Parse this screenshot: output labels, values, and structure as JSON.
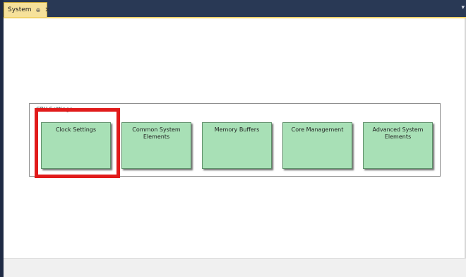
{
  "window": {
    "tab_title": "System",
    "tab_pin_icon": "pin-icon",
    "tab_close_icon": "close-icon",
    "overflow_icon": "chevron-down-icon"
  },
  "group": {
    "title": "CPU Settings"
  },
  "tiles": [
    {
      "label": "Clock Settings"
    },
    {
      "label": "Common System Elements"
    },
    {
      "label": "Memory Buffers"
    },
    {
      "label": "Core Management"
    },
    {
      "label": "Advanced System Elements"
    }
  ],
  "colors": {
    "title_bar": "#293955",
    "tab_background": "#f6e19a",
    "tile_fill": "#a8e0b6",
    "tile_border": "#5e8f69",
    "highlight_border": "#e11b1b"
  }
}
